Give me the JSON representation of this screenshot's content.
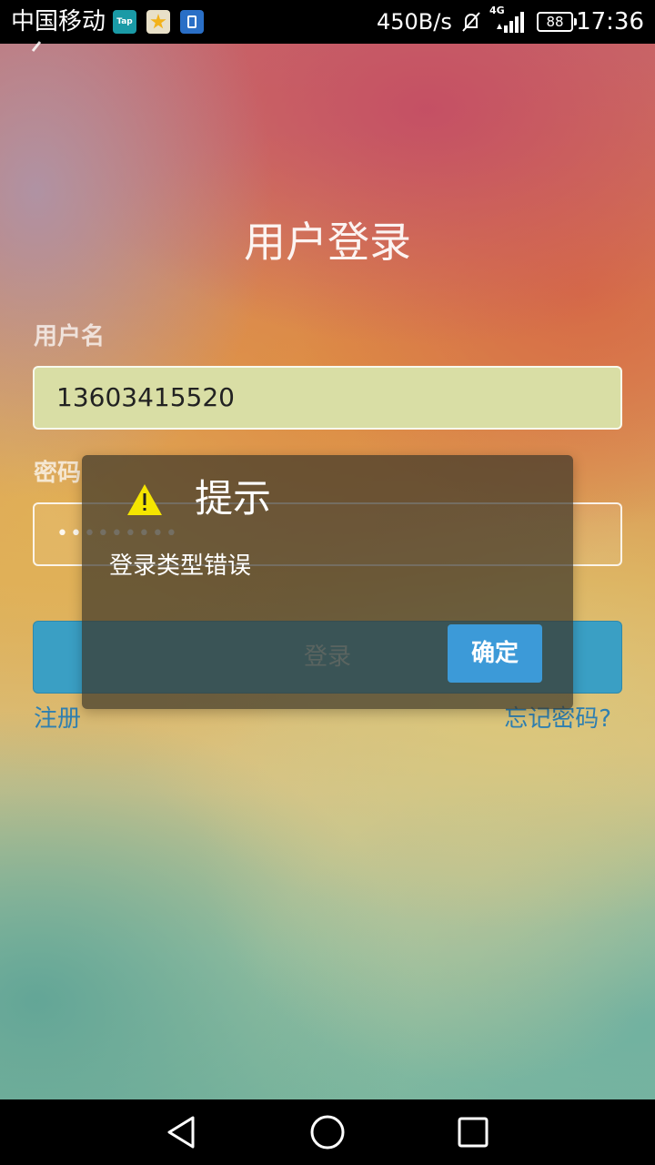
{
  "status_bar": {
    "carrier": "中国移动",
    "notification_apps": [
      {
        "name": "tap-app-icon",
        "label": "Tap"
      },
      {
        "name": "star-app-icon",
        "label": ""
      },
      {
        "name": "document-app-icon",
        "label": ""
      }
    ],
    "net_speed": "450B/s",
    "network_type": "4G",
    "battery_level": "88",
    "time": "17:36"
  },
  "login": {
    "title": "用户登录",
    "username_label": "用户名",
    "username_value": "13603415520",
    "password_label": "密码",
    "password_masked": "•••••••••",
    "login_button": "登录",
    "register_link": "注册",
    "forgot_password_link": "忘记密码?"
  },
  "dialog": {
    "title": "提示",
    "message": "登录类型错误",
    "confirm_button": "确定"
  },
  "colors": {
    "accent": "#3c9ad8",
    "login_button": "#3a9fc4",
    "link": "#2f7fb0",
    "warning": "#f5e500"
  },
  "icons": {
    "back": "back-arrow-icon",
    "warning": "warning-triangle-icon",
    "mute": "mute-icon",
    "signal": "signal-icon",
    "battery": "battery-icon",
    "nav_back": "nav-back-icon",
    "nav_home": "nav-home-icon",
    "nav_recent": "nav-recent-apps-icon"
  }
}
